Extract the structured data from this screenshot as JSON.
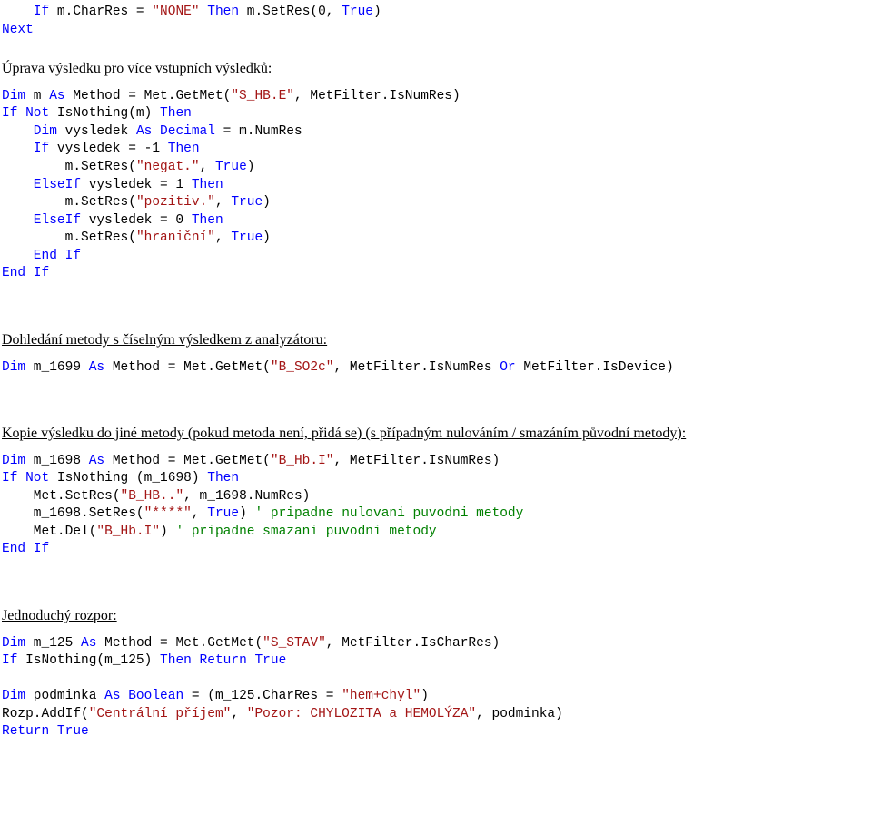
{
  "s1": {
    "l1a": "    If",
    "l1b": " m.CharRes = ",
    "l1c": "\"NONE\"",
    "l1d": " Then",
    "l1e": " m.SetRes(0, ",
    "l1f": "True",
    "l1g": ")",
    "l2": "Next"
  },
  "h1": "Úprava výsledku pro více vstupních výsledků:",
  "s2": {
    "l1a": "Dim",
    "l1b": " m ",
    "l1c": "As",
    "l1d": " Method = Met.GetMet(",
    "l1e": "\"S_HB.E\"",
    "l1f": ", MetFilter.IsNumRes)",
    "l2a": "If",
    "l2b": " Not",
    "l2c": " IsNothing(m) ",
    "l2d": "Then",
    "l3a": "    Dim",
    "l3b": " vysledek ",
    "l3c": "As",
    "l3d": " Decimal",
    "l3e": " = m.NumRes",
    "l4a": "    If",
    "l4b": " vysledek = -1 ",
    "l4c": "Then",
    "l5a": "        m.SetRes(",
    "l5b": "\"negat.\"",
    "l5c": ", ",
    "l5d": "True",
    "l5e": ")",
    "l6a": "    ElseIf",
    "l6b": " vysledek = 1 ",
    "l6c": "Then",
    "l7a": "        m.SetRes(",
    "l7b": "\"pozitiv.\"",
    "l7c": ", ",
    "l7d": "True",
    "l7e": ")",
    "l8a": "    ElseIf",
    "l8b": " vysledek = 0 ",
    "l8c": "Then",
    "l9a": "        m.SetRes(",
    "l9b": "\"hraniční\"",
    "l9c": ", ",
    "l9d": "True",
    "l9e": ")",
    "l10": "    End If",
    "l11": "End If"
  },
  "h2": "Dohledání metody s číselným výsledkem z analyzátoru:",
  "s3": {
    "l1a": "Dim",
    "l1b": " m_1699 ",
    "l1c": "As",
    "l1d": " Method = Met.GetMet(",
    "l1e": "\"B_SO2c\"",
    "l1f": ", MetFilter.IsNumRes ",
    "l1g": "Or",
    "l1h": " MetFilter.IsDevice)"
  },
  "h3": "Kopie výsledku do jiné metody (pokud metoda není, přidá se) (s případným nulováním / smazáním původní metody):",
  "s4": {
    "l1a": "Dim",
    "l1b": " m_1698 ",
    "l1c": "As",
    "l1d": " Method = Met.GetMet(",
    "l1e": "\"B_Hb.I\"",
    "l1f": ", MetFilter.IsNumRes)",
    "l2a": "If",
    "l2b": " Not",
    "l2c": " IsNothing (m_1698) ",
    "l2d": "Then",
    "l3a": "    Met.SetRes(",
    "l3b": "\"B_HB..\"",
    "l3c": ", m_1698.NumRes)",
    "l4a": "    m_1698.SetRes(",
    "l4b": "\"****\"",
    "l4c": ", ",
    "l4d": "True",
    "l4e": ") ",
    "l4f": "' pripadne nulovani puvodni metody",
    "l5a": "    Met.Del(",
    "l5b": "\"B_Hb.I\"",
    "l5c": ") ",
    "l5d": "' pripadne smazani puvodni metody",
    "l6": "End If"
  },
  "h4": "Jednoduchý rozpor:",
  "s5": {
    "l1a": "Dim",
    "l1b": " m_125 ",
    "l1c": "As",
    "l1d": " Method = Met.GetMet(",
    "l1e": "\"S_STAV\"",
    "l1f": ", MetFilter.IsCharRes)",
    "l2a": "If",
    "l2b": " IsNothing(m_125) ",
    "l2c": "Then",
    "l2d": " Return",
    "l2e": " True",
    "l4a": "Dim",
    "l4b": " podminka ",
    "l4c": "As",
    "l4d": " Boolean",
    "l4e": " = (m_125.CharRes = ",
    "l4f": "\"hem+chyl\"",
    "l4g": ")",
    "l5a": "Rozp.AddIf(",
    "l5b": "\"Centrální příjem\"",
    "l5c": ", ",
    "l5d": "\"Pozor: CHYLOZITA a HEMOLÝZA\"",
    "l5e": ", podminka)",
    "l6a": "Return",
    "l6b": " True"
  }
}
